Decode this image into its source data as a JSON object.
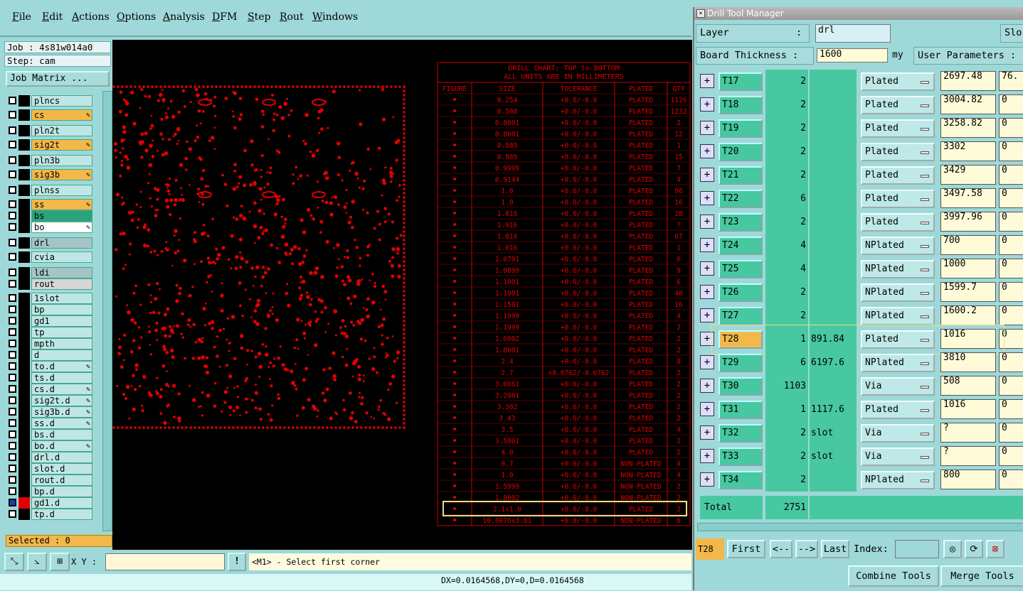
{
  "menu": [
    "File",
    "Edit",
    "Actions",
    "Options",
    "Analysis",
    "DFM",
    "Step",
    "Rout",
    "Windows"
  ],
  "job": {
    "job_line": "Job : 4s81w014a0",
    "step_line": "Step: cam",
    "matrix_button": "Job Matrix ..."
  },
  "layers": [
    {
      "name": "plncs",
      "color": "#bfe6e6",
      "pen": false,
      "swatch": "#000"
    },
    {
      "name": "cs",
      "color": "#f3b849",
      "pen": true,
      "swatch": "#000"
    },
    {
      "name": "pln2t",
      "color": "#bfe6e6",
      "pen": false,
      "swatch": "#000"
    },
    {
      "name": "sig2t",
      "color": "#f3b849",
      "pen": true,
      "swatch": "#000"
    },
    {
      "name": "pln3b",
      "color": "#bfe6e6",
      "pen": false,
      "swatch": "#000"
    },
    {
      "name": "sig3b",
      "color": "#f3b849",
      "pen": true,
      "swatch": "#000"
    },
    {
      "name": "plnss",
      "color": "#bfe6e6",
      "pen": false,
      "swatch": "#000"
    },
    {
      "name": "ss",
      "color": "#f3b849",
      "pen": true,
      "swatch": "#000"
    },
    {
      "name": "bs",
      "color": "#2aa47a",
      "pen": false,
      "swatch": "#000"
    },
    {
      "name": "bo",
      "color": "#ffffff",
      "pen": true,
      "swatch": "#000"
    },
    {
      "name": "drl",
      "color": "#a6c4c8",
      "pen": false,
      "swatch": "#000"
    },
    {
      "name": "cvia",
      "color": "#bfe6e6",
      "pen": false,
      "swatch": "#000"
    },
    {
      "name": "ldi",
      "color": "#a6c4c8",
      "pen": false,
      "swatch": "#000"
    },
    {
      "name": "rout",
      "color": "#d6d6d6",
      "pen": false,
      "swatch": "#000"
    },
    {
      "name": "1slot",
      "color": "#bfe6e6",
      "pen": false,
      "swatch": "#000"
    },
    {
      "name": "bp",
      "color": "#bfe6e6",
      "pen": false,
      "swatch": "#000"
    },
    {
      "name": "gd1",
      "color": "#bfe6e6",
      "pen": false,
      "swatch": "#000"
    },
    {
      "name": "tp",
      "color": "#bfe6e6",
      "pen": false,
      "swatch": "#000"
    },
    {
      "name": "mpth",
      "color": "#bfe6e6",
      "pen": false,
      "swatch": "#000"
    },
    {
      "name": "d",
      "color": "#bfe6e6",
      "pen": false,
      "swatch": "#000"
    },
    {
      "name": "to.d",
      "color": "#bfe6e6",
      "pen": true,
      "swatch": "#000"
    },
    {
      "name": "ts.d",
      "color": "#bfe6e6",
      "pen": false,
      "swatch": "#000"
    },
    {
      "name": "cs.d",
      "color": "#bfe6e6",
      "pen": true,
      "swatch": "#000"
    },
    {
      "name": "sig2t.d",
      "color": "#bfe6e6",
      "pen": true,
      "swatch": "#000"
    },
    {
      "name": "sig3b.d",
      "color": "#bfe6e6",
      "pen": true,
      "swatch": "#000"
    },
    {
      "name": "ss.d",
      "color": "#bfe6e6",
      "pen": true,
      "swatch": "#000"
    },
    {
      "name": "bs.d",
      "color": "#bfe6e6",
      "pen": false,
      "swatch": "#000"
    },
    {
      "name": "bo.d",
      "color": "#bfe6e6",
      "pen": true,
      "swatch": "#000"
    },
    {
      "name": "drl.d",
      "color": "#bfe6e6",
      "pen": false,
      "swatch": "#000"
    },
    {
      "name": "slot.d",
      "color": "#bfe6e6",
      "pen": false,
      "swatch": "#000"
    },
    {
      "name": "rout.d",
      "color": "#bfe6e6",
      "pen": false,
      "swatch": "#000"
    },
    {
      "name": "bp.d",
      "color": "#bfe6e6",
      "pen": false,
      "swatch": "#000"
    },
    {
      "name": "gd1.d",
      "color": "#bfe6e6",
      "pen": false,
      "swatch": "#e00000"
    },
    {
      "name": "tp.d",
      "color": "#bfe6e6",
      "pen": false,
      "swatch": "#000"
    }
  ],
  "selected": "Selected : 0",
  "chart": {
    "title1": "DRILL CHART: TOP to BOTTOM",
    "title2": "ALL UNITS ARE IN MILLIMETERS",
    "headers": [
      "FIGURE",
      "SIZE",
      "TOLERANCE",
      "PLATED",
      "QTY"
    ],
    "rows": [
      [
        "0.254",
        "+0.0/-0.0",
        "PLATED",
        "1126"
      ],
      [
        "0.508",
        "+0.0/-0.0",
        "PLATED",
        "1232"
      ],
      [
        "0.8001",
        "+0.0/-0.0",
        "PLATED",
        "2"
      ],
      [
        "0.8001",
        "+0.0/-0.0",
        "PLATED",
        "12"
      ],
      [
        "0.889",
        "+0.0/-0.0",
        "PLATED",
        "1"
      ],
      [
        "0.889",
        "+0.0/-0.0",
        "PLATED",
        "15"
      ],
      [
        "0.9999",
        "+0.0/-0.0",
        "PLATED",
        "7"
      ],
      [
        "0.9144",
        "+0.0/-0.0",
        "PLATED",
        "4"
      ],
      [
        "1.0",
        "+0.0/-0.0",
        "PLATED",
        "96"
      ],
      [
        "1.0",
        "+0.0/-0.0",
        "PLATED",
        "16"
      ],
      [
        "1.016",
        "+0.0/-0.0",
        "PLATED",
        "28"
      ],
      [
        "1.016",
        "+0.0/-0.0",
        "PLATED",
        "7"
      ],
      [
        "1.016",
        "+0.0/-0.0",
        "PLATED",
        "67"
      ],
      [
        "1.016",
        "+0.0/-0.0",
        "PLATED",
        "1"
      ],
      [
        "1.0701",
        "+0.0/-0.0",
        "PLATED",
        "6"
      ],
      [
        "1.0899",
        "+0.0/-0.0",
        "PLATED",
        "9"
      ],
      [
        "1.1001",
        "+0.0/-0.0",
        "PLATED",
        "6"
      ],
      [
        "1.1001",
        "+0.0/-0.0",
        "PLATED",
        "40"
      ],
      [
        "1.1501",
        "+0.0/-0.0",
        "PLATED",
        "16"
      ],
      [
        "1.1999",
        "+0.0/-0.0",
        "PLATED",
        "4"
      ],
      [
        "1.1999",
        "+0.0/-0.0",
        "PLATED",
        "2"
      ],
      [
        "1.6002",
        "+0.0/-0.0",
        "PLATED",
        "2"
      ],
      [
        "1.8001",
        "+0.0/-0.0",
        "PLATED",
        "2"
      ],
      [
        "2.4",
        "+0.0/-0.0",
        "PLATED",
        "8"
      ],
      [
        "2.7",
        "+0.0762/-0.0762",
        "PLATED",
        "2"
      ],
      [
        "3.0061",
        "+0.0/-0.0",
        "PLATED",
        "2"
      ],
      [
        "3.2801",
        "+0.0/-0.0",
        "PLATED",
        "2"
      ],
      [
        "3.302",
        "+0.0/-0.0",
        "PLATED",
        "2"
      ],
      [
        "3.43",
        "+0.0/-0.0",
        "PLATED",
        "2"
      ],
      [
        "3.5",
        "+0.0/-0.0",
        "PLATED",
        "4"
      ],
      [
        "3.5001",
        "+0.0/-0.0",
        "PLATED",
        "2"
      ],
      [
        "4.0",
        "+0.0/-0.0",
        "PLATED",
        "2"
      ],
      [
        "0.7",
        "+0.0/-0.0",
        "NON-PLATED",
        "4"
      ],
      [
        "1.0",
        "+0.0/-0.0",
        "NON-PLATED",
        "4"
      ],
      [
        "1.5999",
        "+0.0/-0.0",
        "NON-PLATED",
        "2"
      ],
      [
        "1.8002",
        "+0.0/-0.0",
        "NON-PLATED",
        "2"
      ],
      [
        "2.1x1.0",
        "+0.0/-0.0",
        "PLATED",
        "2"
      ],
      [
        "10.0076x3.81",
        "+0.0/-0.0",
        "NON-PLATED",
        "6"
      ]
    ]
  },
  "toolbar": {
    "xy_label": "X Y :",
    "prompt": "<M1> - Select first corner"
  },
  "status": "DX=0.0164568,DY=0,D=0.0164568",
  "dtm": {
    "title": "Drill Tool Manager",
    "layer_label": "Layer",
    "layer_colon": ":",
    "layer_value": "drl",
    "slot_label": "Slo",
    "thick_label": "Board Thickness :",
    "thick_value": "1600",
    "thick_unit": "my",
    "user_params": "User Parameters :",
    "tools": [
      {
        "name": "T17",
        "count": "2",
        "size": "",
        "type": "Plated",
        "fin": "2697.48",
        "fin2": "76."
      },
      {
        "name": "T18",
        "count": "2",
        "size": "",
        "type": "Plated",
        "fin": "3004.82",
        "fin2": "0"
      },
      {
        "name": "T19",
        "count": "2",
        "size": "",
        "type": "Plated",
        "fin": "3258.82",
        "fin2": "0"
      },
      {
        "name": "T20",
        "count": "2",
        "size": "",
        "type": "Plated",
        "fin": "3302",
        "fin2": "0"
      },
      {
        "name": "T21",
        "count": "2",
        "size": "",
        "type": "Plated",
        "fin": "3429",
        "fin2": "0"
      },
      {
        "name": "T22",
        "count": "6",
        "size": "",
        "type": "Plated",
        "fin": "3497.58",
        "fin2": "0"
      },
      {
        "name": "T23",
        "count": "2",
        "size": "",
        "type": "Plated",
        "fin": "3997.96",
        "fin2": "0"
      },
      {
        "name": "T24",
        "count": "4",
        "size": "",
        "type": "NPlated",
        "fin": "700",
        "fin2": "0"
      },
      {
        "name": "T25",
        "count": "4",
        "size": "",
        "type": "NPlated",
        "fin": "1000",
        "fin2": "0"
      },
      {
        "name": "T26",
        "count": "2",
        "size": "",
        "type": "NPlated",
        "fin": "1599.7",
        "fin2": "0"
      },
      {
        "name": "T27",
        "count": "2",
        "size": "",
        "type": "NPlated",
        "fin": "1600.2",
        "fin2": "0"
      },
      {
        "name": "T28",
        "count": "1",
        "size": "891.84",
        "type": "Plated",
        "fin": "1016",
        "fin2": "0"
      },
      {
        "name": "T29",
        "count": "6",
        "size": "6197.6",
        "type": "NPlated",
        "fin": "3810",
        "fin2": "0"
      },
      {
        "name": "T30",
        "count": "1103",
        "size": "",
        "type": "Via",
        "fin": "508",
        "fin2": "0"
      },
      {
        "name": "T31",
        "count": "1",
        "size": "1117.6",
        "type": "Plated",
        "fin": "1016",
        "fin2": "0"
      },
      {
        "name": "T32",
        "count": "2",
        "size": "slot",
        "type": "Via",
        "fin": "?",
        "fin2": "0"
      },
      {
        "name": "T33",
        "count": "2",
        "size": "slot",
        "type": "Via",
        "fin": "?",
        "fin2": "0"
      },
      {
        "name": "T34",
        "count": "2",
        "size": "",
        "type": "NPlated",
        "fin": "800",
        "fin2": "0"
      }
    ],
    "total_label": "Total",
    "total_value": "2751",
    "current_tool": "T28",
    "nav_first": "First",
    "nav_prev": "<--",
    "nav_next": "-->",
    "nav_last": "Last",
    "index_label": "Index:",
    "combine": "Combine Tools",
    "merge": "Merge Tools"
  },
  "colors": {
    "accent_orange": "#f3b849",
    "cad_red": "#e00000",
    "tool_green": "#48c8a0"
  }
}
